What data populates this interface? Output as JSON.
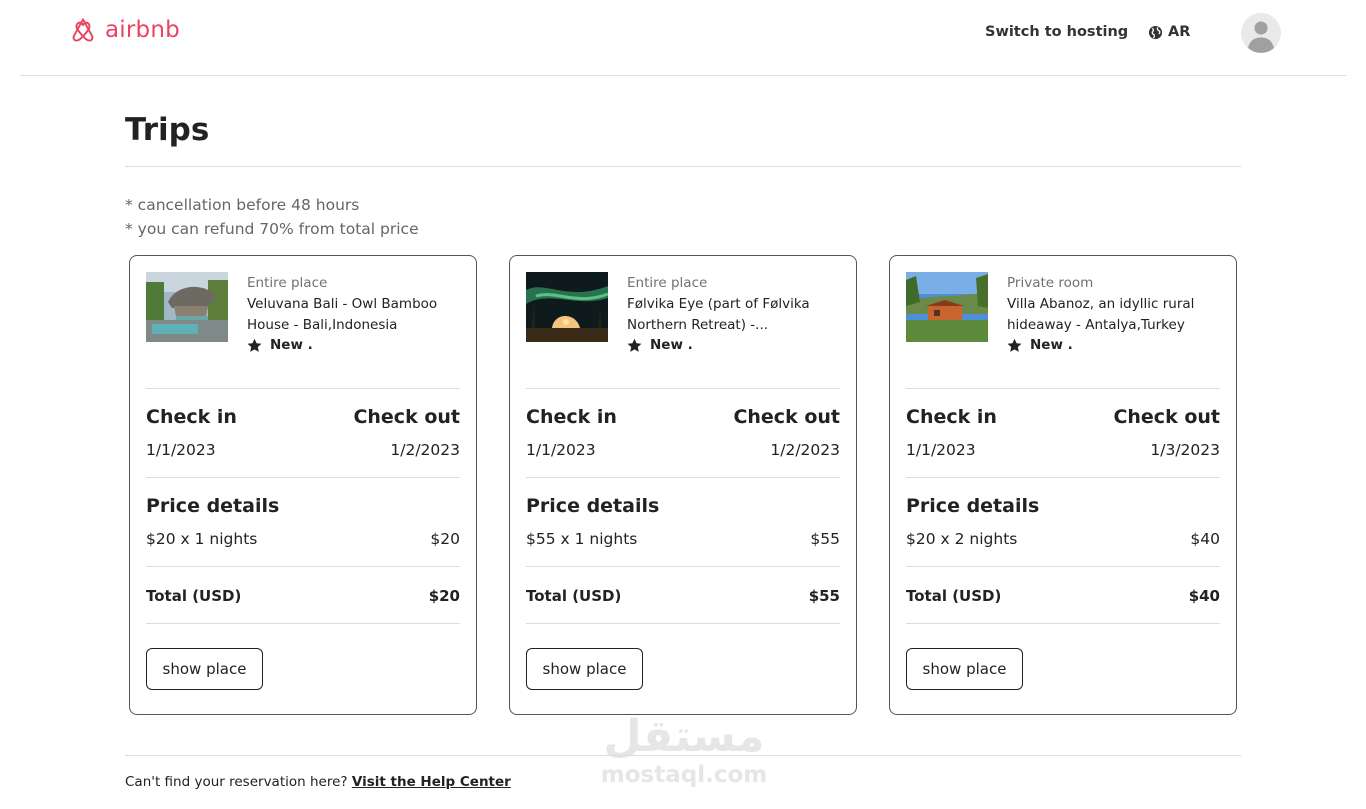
{
  "header": {
    "logo_text": "airbnb",
    "brand_color": "#e94560",
    "switch_hosting": "Switch to hosting",
    "language": "AR"
  },
  "page": {
    "title": "Trips",
    "notes": [
      "* cancellation before 48 hours",
      "* you can refund 70% from total price"
    ]
  },
  "labels": {
    "check_in": "Check in",
    "check_out": "Check out",
    "price_details": "Price details",
    "total": "Total (USD)",
    "show_place": "show place",
    "rating": "New ."
  },
  "trips": [
    {
      "type": "Entire place",
      "name": "Veluvana Bali - Owl Bamboo House - Bali,Indonesia",
      "check_in": "1/1/2023",
      "check_out": "1/2/2023",
      "price_line": "$20 x 1 nights",
      "price_amount": "$20",
      "total": "$20"
    },
    {
      "type": "Entire place",
      "name": "Følvika Eye (part of Følvika Northern Retreat) -...",
      "check_in": "1/1/2023",
      "check_out": "1/2/2023",
      "price_line": "$55 x 1 nights",
      "price_amount": "$55",
      "total": "$55"
    },
    {
      "type": "Private room",
      "name": "Villa Abanoz, an idyllic rural hideaway - Antalya,Turkey",
      "check_in": "1/1/2023",
      "check_out": "1/3/2023",
      "price_line": "$20 x 2 nights",
      "price_amount": "$40",
      "total": "$40"
    }
  ],
  "footer": {
    "text": "Can't find your reservation here? ",
    "link": "Visit the Help Center"
  },
  "watermark": {
    "arabic": "مستقل",
    "latin": "mostaql.com"
  }
}
